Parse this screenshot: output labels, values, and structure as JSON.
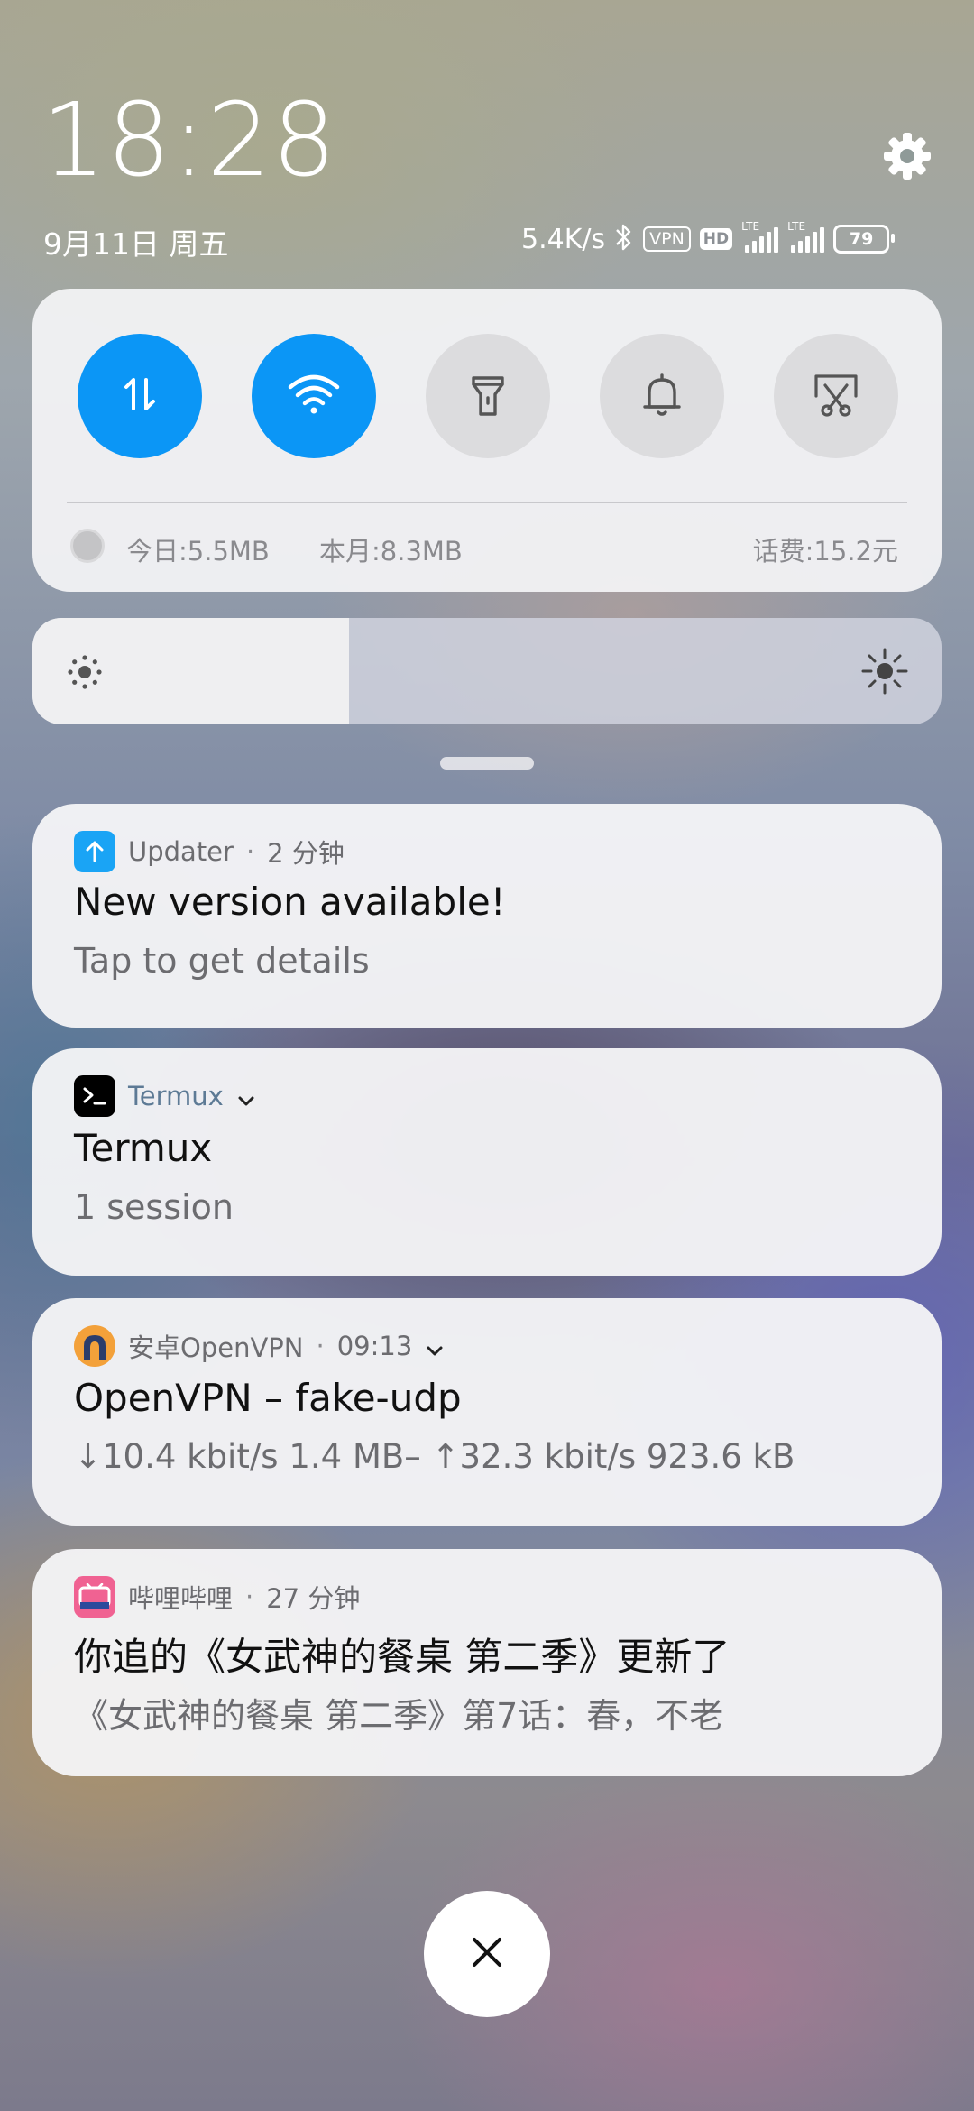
{
  "status": {
    "time": "18:28",
    "date": "9月11日 周五",
    "net_speed": "5.4K/s",
    "vpn_badge": "VPN",
    "hd_badge": "HD",
    "sim1_label": "LTE",
    "sim2_label": "LTE",
    "battery": "79"
  },
  "quick_settings": {
    "toggles": [
      {
        "name": "mobile-data",
        "state": "on"
      },
      {
        "name": "wifi",
        "state": "on"
      },
      {
        "name": "flashlight",
        "state": "off"
      },
      {
        "name": "notification-sound",
        "state": "off"
      },
      {
        "name": "screenshot",
        "state": "off"
      }
    ],
    "usage_today": "今日:5.5MB",
    "usage_month": "本月:8.3MB",
    "balance": "话费:15.2元"
  },
  "brightness": {
    "level": 0.348
  },
  "notifications": [
    {
      "app": "Updater",
      "sep": "·",
      "time": "2 分钟",
      "title": "New version available!",
      "body": "Tap to get details"
    },
    {
      "app": "Termux",
      "title": "Termux",
      "body": "1 session"
    },
    {
      "app": "安卓OpenVPN",
      "sep": "·",
      "time": "09:13",
      "title": "OpenVPN – fake-udp",
      "body": "↓10.4 kbit/s 1.4 MB– ↑32.3 kbit/s 923.6 kB"
    },
    {
      "app": "哔哩哔哩",
      "sep": "·",
      "time": "27 分钟",
      "title": "你追的《女武神的餐桌 第二季》更新了",
      "body": "《女武神的餐桌 第二季》第7话：春，不老"
    }
  ],
  "colors": {
    "accent": "#0b96f6",
    "updater_icon": "#1aa4f5",
    "bilibili_icon": "#f06292"
  }
}
